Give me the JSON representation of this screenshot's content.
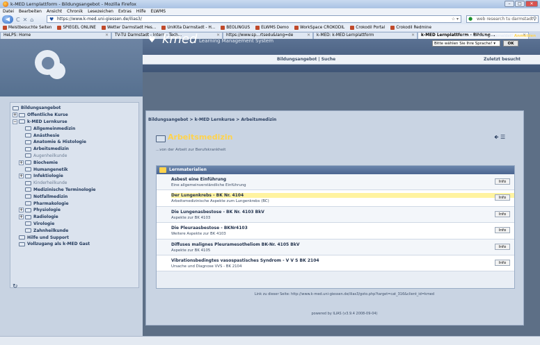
{
  "window": {
    "title": "k-MED Lernplattform - Bildungsangebot - Mozilla Firefox",
    "minimize": "–",
    "maximize": "□",
    "close": "✕"
  },
  "menu": [
    "Datei",
    "Bearbeiten",
    "Ansicht",
    "Chronik",
    "Lesezeichen",
    "Extras",
    "Hilfe",
    "ELWMS"
  ],
  "nav": {
    "url": "https://www.k-med.uni-giessen.de/ilias3/",
    "search_placeholder": "web research tu darmstadt"
  },
  "bookmarks": [
    "Meistbesuchte Seiten",
    "SPIEGEL ONLINE",
    "Wetter Darmstadt Hes...",
    "UniKita Darmstadt - H...",
    "BEOLINGUS",
    "ELWMS Demo",
    "WorkSpace CROKODIL",
    "Crokodil Portal",
    "Crokodil Redmine"
  ],
  "tabs": [
    {
      "label": "HeLPS: Home"
    },
    {
      "label": "TV-TU Darmstadt - Intern - Tech..."
    },
    {
      "label": "https://www.sp...rtsedu&lang=de"
    },
    {
      "label": "k-MED: k-MED Lernplattform"
    },
    {
      "label": "k-MED Lernplattform - Bildung...",
      "active": true
    }
  ],
  "header": {
    "brand": "kmed",
    "lms": "Learning Management System",
    "login_text": "Sie sind nicht angemeldet!",
    "login_link": "Anmelden",
    "lang_placeholder": "Bitte wählen Sie Ihre Sprache!",
    "ok": "OK"
  },
  "subnav": {
    "links": "Bildungsangebot  |  Suche",
    "recent": "Zuletzt besucht"
  },
  "tree": [
    {
      "label": "Bildungsangebot",
      "level": 0,
      "bold": true
    },
    {
      "label": "Offentliche Kurse",
      "level": 1,
      "toggle": "+"
    },
    {
      "label": "k-MED Lernkurse",
      "level": 1,
      "toggle": "-"
    },
    {
      "label": "Allgemeinmedizin",
      "level": 2
    },
    {
      "label": "Anästhesie",
      "level": 2
    },
    {
      "label": "Anatomie & Histologie",
      "level": 2
    },
    {
      "label": "Arbeitsmedizin",
      "level": 2
    },
    {
      "label": "Augenheilkunde",
      "level": 2,
      "muted": true
    },
    {
      "label": "Biochemie",
      "level": 2,
      "toggle": "+"
    },
    {
      "label": "Humangenetik",
      "level": 2
    },
    {
      "label": "Infektiologie",
      "level": 2,
      "toggle": "+"
    },
    {
      "label": "Kinderheilkunde",
      "level": 2,
      "muted": true
    },
    {
      "label": "Medizinische Terminologie",
      "level": 2
    },
    {
      "label": "Notfallmedizin",
      "level": 2
    },
    {
      "label": "Pharmakologie",
      "level": 2
    },
    {
      "label": "Physiologie",
      "level": 2,
      "toggle": "+"
    },
    {
      "label": "Radiologie",
      "level": 2,
      "toggle": "+"
    },
    {
      "label": "Virologie",
      "level": 2
    },
    {
      "label": "Zahnheilkunde",
      "level": 2
    },
    {
      "label": "Hilfe und Support",
      "level": 1
    },
    {
      "label": "Vollzugang als k-MED Gast",
      "level": 1
    }
  ],
  "breadcrumb": "Bildungsangebot > k-MED Lernkurse > Arbeitsmedizin",
  "page": {
    "title": "Arbeitsmedizin",
    "subtitle": "...von der Arbeit zur Berufskrankheit"
  },
  "lernmaterialien": {
    "heading": "Lernmaterialien",
    "items": [
      {
        "title": "Asbest eine Einführung",
        "desc": "Eine allgemeinverständliche Einführung",
        "btn": "Info"
      },
      {
        "title": "Der Lungenkrebs - BK Nr. 4104",
        "desc": "Arbeitsmedizinische Aspekte zum Lungenkrebs (BC)",
        "btn": "Info",
        "selected": true
      },
      {
        "title": "Die Lungenasbestose - BK Nr. 4103 BkV",
        "desc": "Aspekte zur BK 4103",
        "btn": "Info"
      },
      {
        "title": "Die Pleuraasbestose - BKNr4103",
        "desc": "Weitere Aspekte zur BK 4103",
        "btn": "Info"
      },
      {
        "title": "Diffuses malignes Pleuramesotheliom BK-Nr. 4105 BkV",
        "desc": "Aspekte zur BK 4105",
        "btn": "Info"
      },
      {
        "title": "Vibrationsbedingtes vasospastisches Syndrom - V V S BK 2104",
        "desc": "Ursache und Diagnose VVS - BK 2104",
        "btn": "Info"
      }
    ]
  },
  "footer": {
    "link": "Link zu dieser Seite: http://www.k-med.uni-giessen.de/ilias3/goto.php?target=cat_316&client_id=kmed",
    "powered": "powered by ILIAS (v3.9.4 2008-09-04)"
  }
}
